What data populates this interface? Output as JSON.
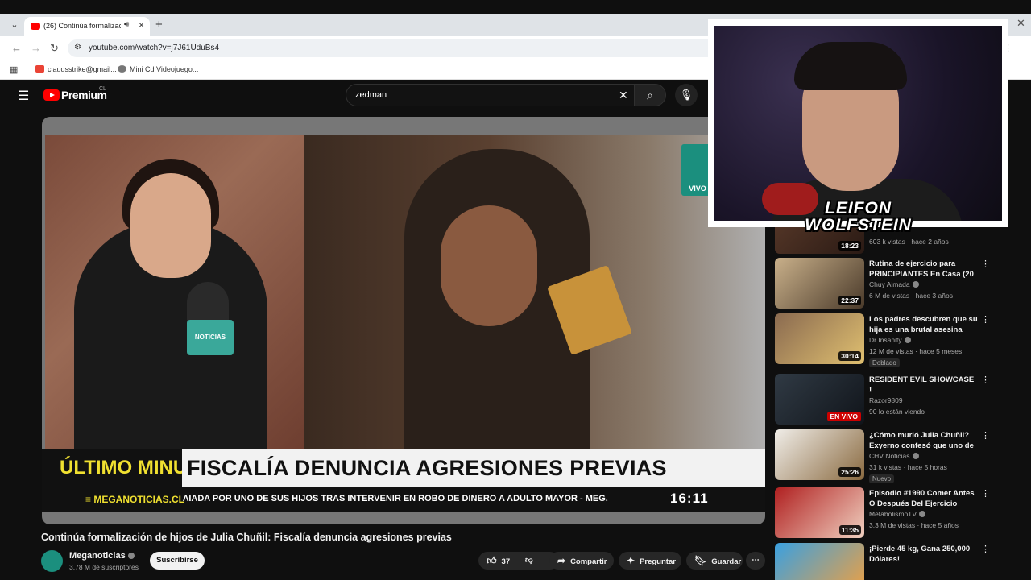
{
  "browser": {
    "tab_title": "(26) Continúa formalizació",
    "address": "youtube.com/watch?v=j7J61UduBs4",
    "bookmarks": [
      {
        "label": "claudsstrike@gmail..."
      },
      {
        "label": "Mini Cd Videojuego..."
      }
    ]
  },
  "header": {
    "brand": "Premium",
    "country": "CL",
    "search_query": "zedman"
  },
  "video": {
    "ultimo": "ÚLTIMO MINUTO",
    "headline": "FISCALÍA DENUNCIA AGRESIONES PREVIAS",
    "ticker_site": "≡ MEGANOTICIAS.CL",
    "ticker_msg": "ɅIADA POR UNO DE SUS HIJOS TRAS INTERVENIR EN ROBO DE DINERO A ADULTO MAYOR - MEG.",
    "ticker_time": "16:11",
    "logo_text": "VIVO",
    "mic_label": "NOTICIAS",
    "title": "Continúa formalización de hijos de Julia Chuñil: Fiscalía denuncia agresiones previas"
  },
  "channel": {
    "name": "Meganoticias",
    "subs": "3.78 M de suscriptores",
    "subscribe_label": "Suscribirse"
  },
  "actions": {
    "likes": "37",
    "share": "Compartir",
    "ask": "Preguntar",
    "save": "Guardar"
  },
  "overlay": {
    "streamer_line1": "LEIFON",
    "streamer_line2": "WOLFSTEIN"
  },
  "sidebar": [
    {
      "title": "",
      "channel": "",
      "meta": "603 k vistas · hace 2 años",
      "duration": "18:23",
      "colors": [
        "#5a3a2a",
        "#2a1a14"
      ]
    },
    {
      "title": "Rutina de ejercicio para PRINCIPIANTES En Casa (20 ...",
      "channel": "Chuy Almada",
      "meta": "6 M de vistas · hace 3 años",
      "duration": "22:37",
      "colors": [
        "#c9b08a",
        "#4a3a2a"
      ]
    },
    {
      "title": "Los padres descubren que su hija es una brutal asesina",
      "channel": "Dr Insanity",
      "meta": "12 M de vistas · hace 5 meses",
      "duration": "30:14",
      "tag": "Doblado",
      "colors": [
        "#8a6a50",
        "#e0c070"
      ]
    },
    {
      "title": "RESIDENT EVIL SHOWCASE !",
      "channel": "Razor9809",
      "meta": "90 lo están viendo",
      "duration": "EN VIVO",
      "live": true,
      "colors": [
        "#303a44",
        "#10141a"
      ]
    },
    {
      "title": "¿Cómo murió Julia Chuñil? Exyerno confesó que uno de ...",
      "channel": "CHV Noticias",
      "meta": "31 k vistas · hace 5 horas",
      "duration": "25:26",
      "tag": "Nuevo",
      "colors": [
        "#f0ede8",
        "#8a6a40"
      ]
    },
    {
      "title": "Episodio #1990 Comer Antes O Después Del Ejercicio",
      "channel": "MetabolismoTV",
      "meta": "3.3 M de vistas · hace 5 años",
      "duration": "11:35",
      "colors": [
        "#b02020",
        "#f0d0c0"
      ]
    },
    {
      "title": "¡Pierde 45 kg, Gana 250,000 Dólares!",
      "channel": "",
      "meta": "",
      "duration": "",
      "colors": [
        "#3aa0e0",
        "#f0a040"
      ]
    }
  ]
}
